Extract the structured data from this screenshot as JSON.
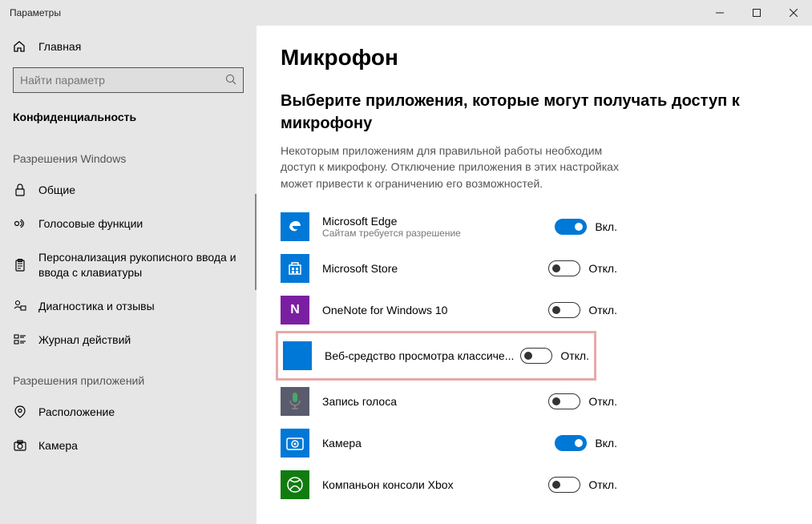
{
  "window": {
    "title": "Параметры"
  },
  "sidebar": {
    "home": "Главная",
    "search_placeholder": "Найти параметр",
    "category": "Конфиденциальность",
    "section1": "Разрешения Windows",
    "section2": "Разрешения приложений",
    "items1": [
      {
        "label": "Общие"
      },
      {
        "label": "Голосовые функции"
      },
      {
        "label": "Персонализация рукописного ввода и ввода с клавиатуры"
      },
      {
        "label": "Диагностика и отзывы"
      },
      {
        "label": "Журнал действий"
      }
    ],
    "items2": [
      {
        "label": "Расположение"
      },
      {
        "label": "Камера"
      }
    ]
  },
  "main": {
    "title": "Микрофон",
    "subtitle": "Выберите приложения, которые могут получать доступ к микрофону",
    "description": "Некоторым приложениям для правильной работы необходим доступ к микрофону. Отключение приложения в этих настройках может привести к ограничению его возможностей.",
    "on_label": "Вкл.",
    "off_label": "Откл.",
    "apps": [
      {
        "name": "Microsoft Edge",
        "sub": "Сайтам требуется разрешение",
        "on": true,
        "color": "#0078d7",
        "icon": "edge"
      },
      {
        "name": "Microsoft Store",
        "sub": "",
        "on": false,
        "color": "#0078d7",
        "icon": "store"
      },
      {
        "name": "OneNote for Windows 10",
        "sub": "",
        "on": false,
        "color": "#333",
        "icon": "onenote"
      },
      {
        "name": "Веб-средство просмотра классиче...",
        "sub": "",
        "on": false,
        "color": "#0078d7",
        "icon": "blank",
        "highlight": true
      },
      {
        "name": "Запись голоса",
        "sub": "",
        "on": false,
        "color": "#5b5b6e",
        "icon": "voice"
      },
      {
        "name": "Камера",
        "sub": "",
        "on": true,
        "color": "#0078d7",
        "icon": "camera"
      },
      {
        "name": "Компаньон консоли Xbox",
        "sub": "",
        "on": false,
        "color": "#107c10",
        "icon": "xbox"
      }
    ]
  }
}
